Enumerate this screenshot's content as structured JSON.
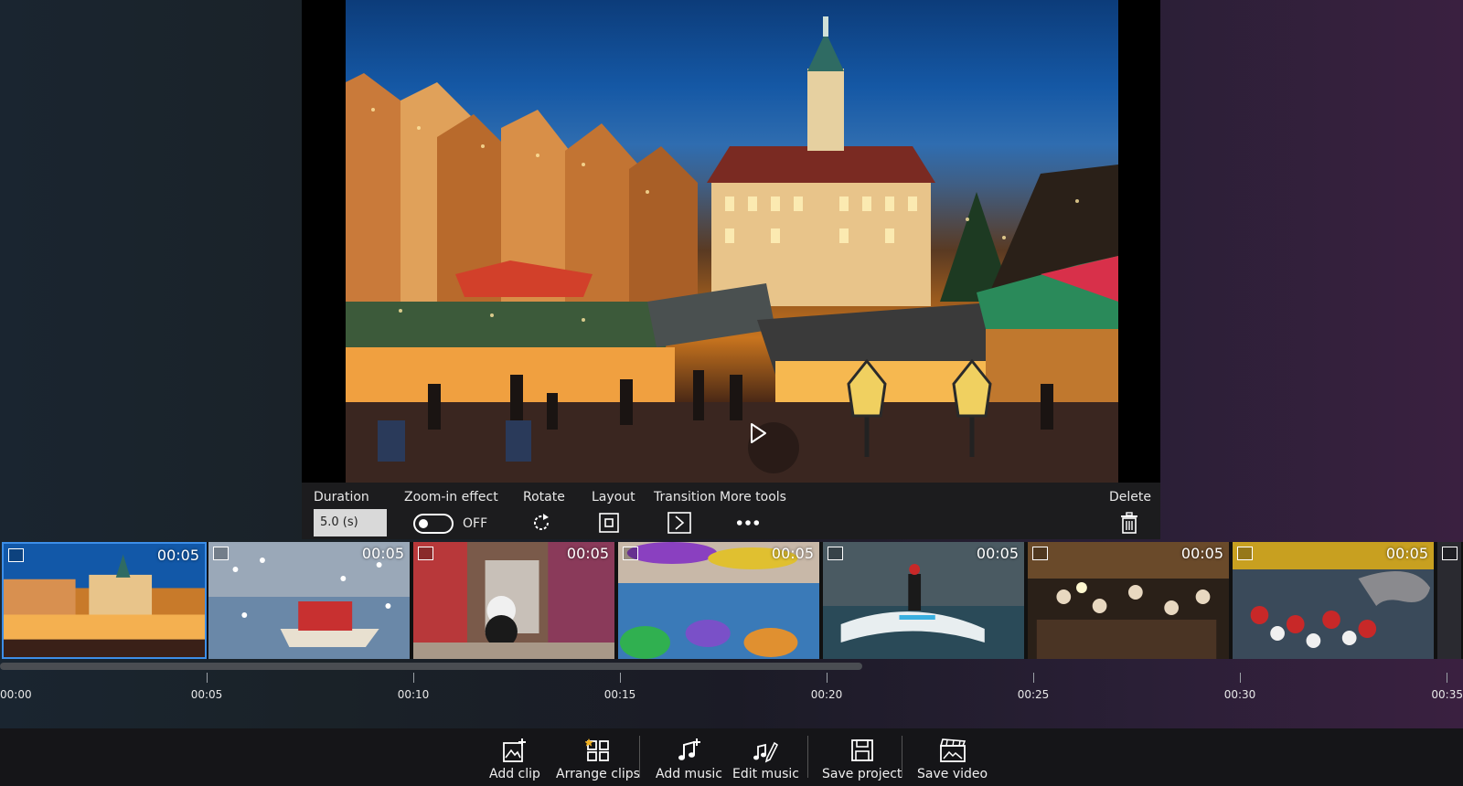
{
  "tools": {
    "duration_label": "Duration",
    "duration_value": "5.0 (s)",
    "zoom_label": "Zoom-in effect",
    "zoom_state": "OFF",
    "rotate_label": "Rotate",
    "layout_label": "Layout",
    "transition_label": "Transition",
    "more_tools_label": "More tools",
    "delete_label": "Delete"
  },
  "clips": [
    {
      "time": "00:05",
      "scene": "christmas-market"
    },
    {
      "time": "00:05",
      "scene": "boat-seagulls"
    },
    {
      "time": "00:05",
      "scene": "panda-shop"
    },
    {
      "time": "00:05",
      "scene": "beach-umbrellas"
    },
    {
      "time": "00:05",
      "scene": "surfer"
    },
    {
      "time": "00:05",
      "scene": "crowd-market"
    },
    {
      "time": "00:05",
      "scene": "elephant-crowd"
    }
  ],
  "timeline": {
    "ticks": [
      "00:00",
      "00:05",
      "00:10",
      "00:15",
      "00:20",
      "00:25",
      "00:30",
      "00:35"
    ]
  },
  "bottom_bar": {
    "add_clip": "Add clip",
    "arrange_clips": "Arrange clips",
    "add_music": "Add music",
    "edit_music": "Edit music",
    "save_project": "Save project",
    "save_video": "Save video"
  },
  "colors": {
    "accent": "#3c8ee8",
    "panel": "#1c1c1e",
    "bottom_bar": "#151518"
  }
}
